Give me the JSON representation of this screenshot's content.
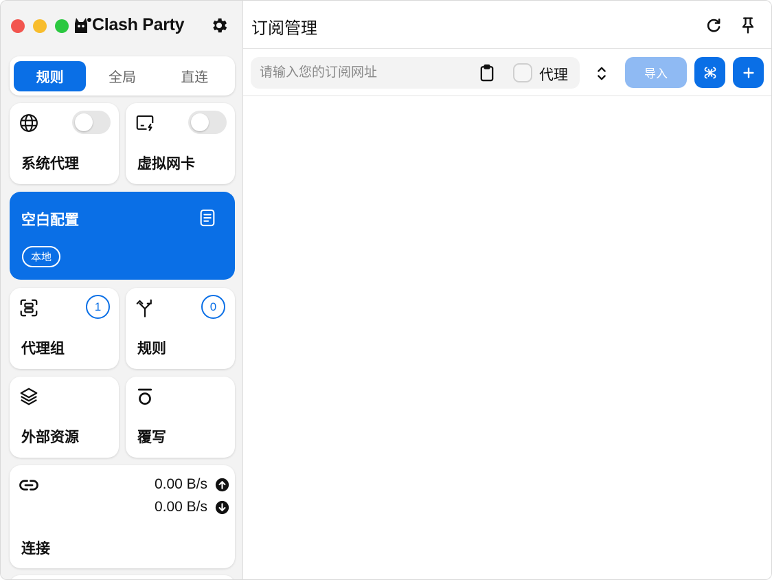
{
  "app": {
    "title": "Clash Party",
    "colors": {
      "accent": "#0a6fe6",
      "accent_disabled": "#8fbaf3"
    }
  },
  "window_controls": [
    "close",
    "minimize",
    "maximize"
  ],
  "sidebar": {
    "mode_tabs": [
      {
        "label": "规则",
        "active": true
      },
      {
        "label": "全局",
        "active": false
      },
      {
        "label": "直连",
        "active": false
      }
    ],
    "system_proxy": {
      "label": "系统代理",
      "icon": "globe-icon",
      "enabled": false
    },
    "tun": {
      "label": "虚拟网卡",
      "icon": "screen-bolt-icon",
      "enabled": false
    },
    "profile": {
      "name": "空白配置",
      "tag": "本地",
      "icon": "document-icon"
    },
    "proxy_groups": {
      "label": "代理组",
      "count": "1",
      "icon": "scan-icon"
    },
    "rules": {
      "label": "规则",
      "count": "0",
      "icon": "fork-icon"
    },
    "resources": {
      "label": "外部资源",
      "icon": "layers-icon"
    },
    "override": {
      "label": "覆写",
      "icon": "override-icon"
    },
    "connections": {
      "label": "连接",
      "upload": "0.00 B/s",
      "download": "0.00 B/s",
      "icon": "link-icon"
    }
  },
  "main": {
    "title": "订阅管理",
    "url_input": {
      "placeholder": "请输入您的订阅网址",
      "value": ""
    },
    "proxy_checkbox": {
      "label": "代理",
      "checked": false
    },
    "import_label": "导入",
    "header_icons": [
      "refresh-icon",
      "pin-icon"
    ]
  }
}
